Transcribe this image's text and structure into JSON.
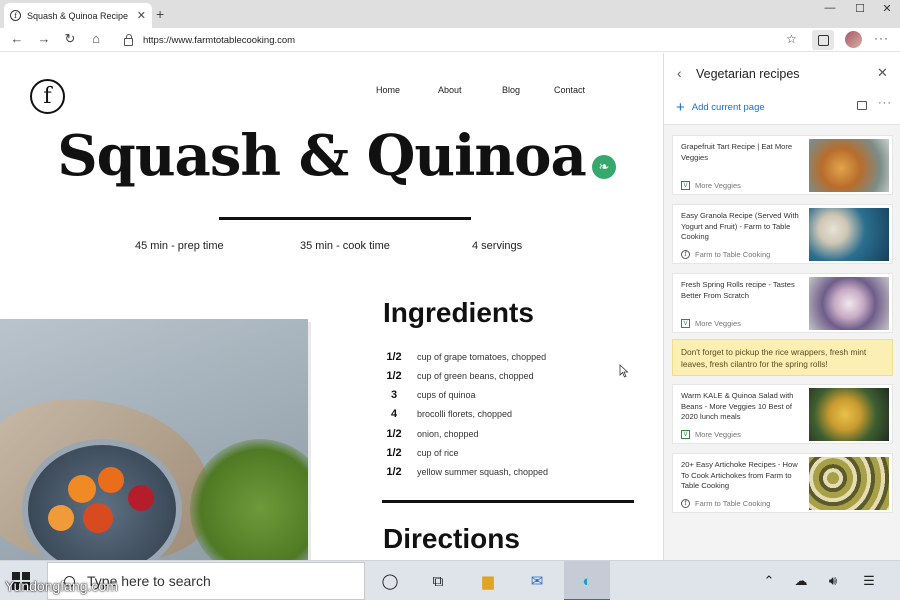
{
  "browser": {
    "tab_title": "Squash & Quinoa Recipe",
    "url": "https://www.farmtotablecooking.com"
  },
  "site": {
    "logo_letter": "f",
    "nav": [
      "Home",
      "About",
      "Blog",
      "Contact"
    ],
    "hero_title": "Squash & Quinoa",
    "meta": [
      "45 min - prep time",
      "35 min - cook time",
      "4 servings"
    ],
    "ingredients_title": "Ingredients",
    "ingredients": [
      {
        "qty": "1/2",
        "item": "cup of grape tomatoes, chopped"
      },
      {
        "qty": "1/2",
        "item": "cup of green beans, chopped"
      },
      {
        "qty": "3",
        "item": "cups of quinoa"
      },
      {
        "qty": "4",
        "item": "brocolli florets, chopped"
      },
      {
        "qty": "1/2",
        "item": "onion, chopped"
      },
      {
        "qty": "1/2",
        "item": "cup of rice"
      },
      {
        "qty": "1/2",
        "item": "yellow summer squash, chopped"
      }
    ],
    "directions_title": "Directions"
  },
  "collections_panel": {
    "title": "Vegetarian recipes",
    "add_label": "Add current page",
    "items": [
      {
        "title": "Grapefruit Tart Recipe | Eat More Veggies",
        "source": "More Veggies",
        "source_icon": "V"
      },
      {
        "title": "Easy Granola Recipe (Served With Yogurt and Fruit) - Farm to Table Cooking",
        "source": "Farm to Table Cooking",
        "source_icon": "f"
      },
      {
        "title": "Fresh Spring Rolls recipe - Tastes Better From Scratch",
        "source": "More Veggies",
        "source_icon": "V"
      },
      {
        "title": "Warm KALE & Quinoa Salad with Beans - More Veggies 10 Best of 2020 lunch meals",
        "source": "More Veggies",
        "source_icon": "V"
      },
      {
        "title": "20+ Easy Artichoke Recipes - How To Cook Artichokes from Farm to Table Cooking",
        "source": "Farm to Table Cooking",
        "source_icon": "f"
      }
    ],
    "note": "Don't forget to pickup the rice wrappers, fresh mint leaves, fresh cilantro for the spring rolls!"
  },
  "taskbar": {
    "search_placeholder": "Type here to search",
    "watermark": "Yundongfang.com"
  },
  "colors": {
    "accent": "#1a6fc9",
    "leaf_badge": "#35a86b",
    "note_bg": "#fcefb4"
  }
}
